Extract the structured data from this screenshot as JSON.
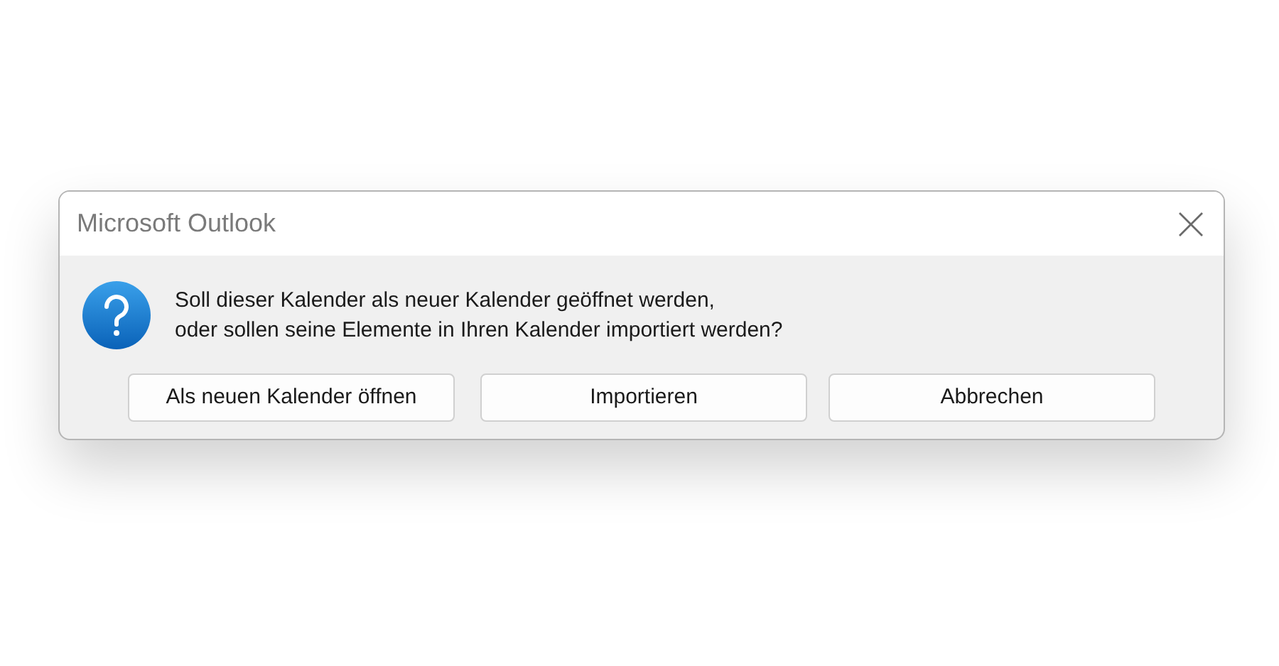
{
  "window": {
    "title": "Microsoft Outlook"
  },
  "message": "Soll dieser Kalender als neuer Kalender geöffnet werden,\noder sollen seine Elemente in Ihren Kalender importiert werden?",
  "buttons": [
    {
      "label": "Als neuen Kalender öffnen"
    },
    {
      "label": "Importieren"
    },
    {
      "label": "Abbrechen"
    }
  ]
}
